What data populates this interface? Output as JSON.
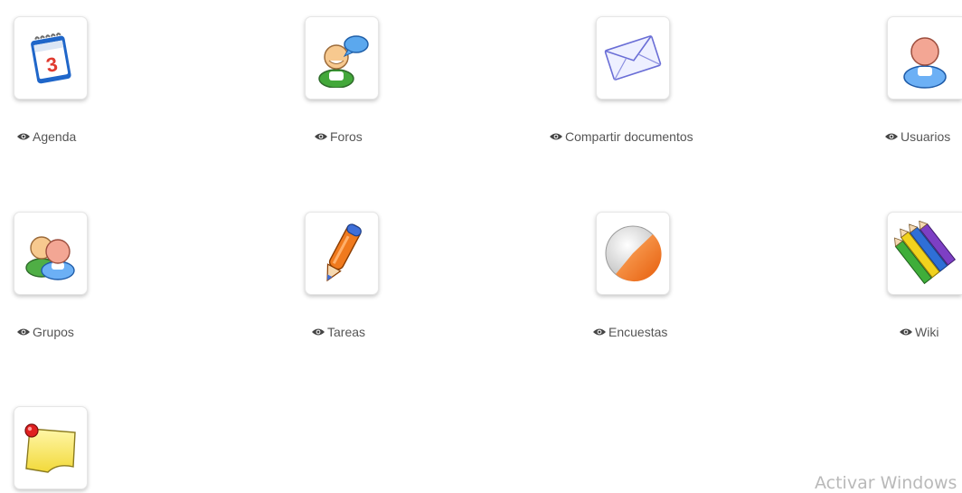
{
  "tools": [
    {
      "label": "Agenda",
      "icon": "calendar-icon"
    },
    {
      "label": "Foros",
      "icon": "forum-chat-icon"
    },
    {
      "label": "Compartir documentos",
      "icon": "envelope-icon"
    },
    {
      "label": "Usuarios",
      "icon": "user-icon"
    },
    {
      "label": "Grupos",
      "icon": "group-users-icon"
    },
    {
      "label": "Tareas",
      "icon": "pencil-icon"
    },
    {
      "label": "Encuestas",
      "icon": "pie-chart-icon"
    },
    {
      "label": "Wiki",
      "icon": "colored-pencils-icon"
    },
    {
      "label": "",
      "icon": "sticky-note-icon"
    }
  ],
  "visibility_icon": "eye-icon",
  "watermark": "Activar Windows"
}
